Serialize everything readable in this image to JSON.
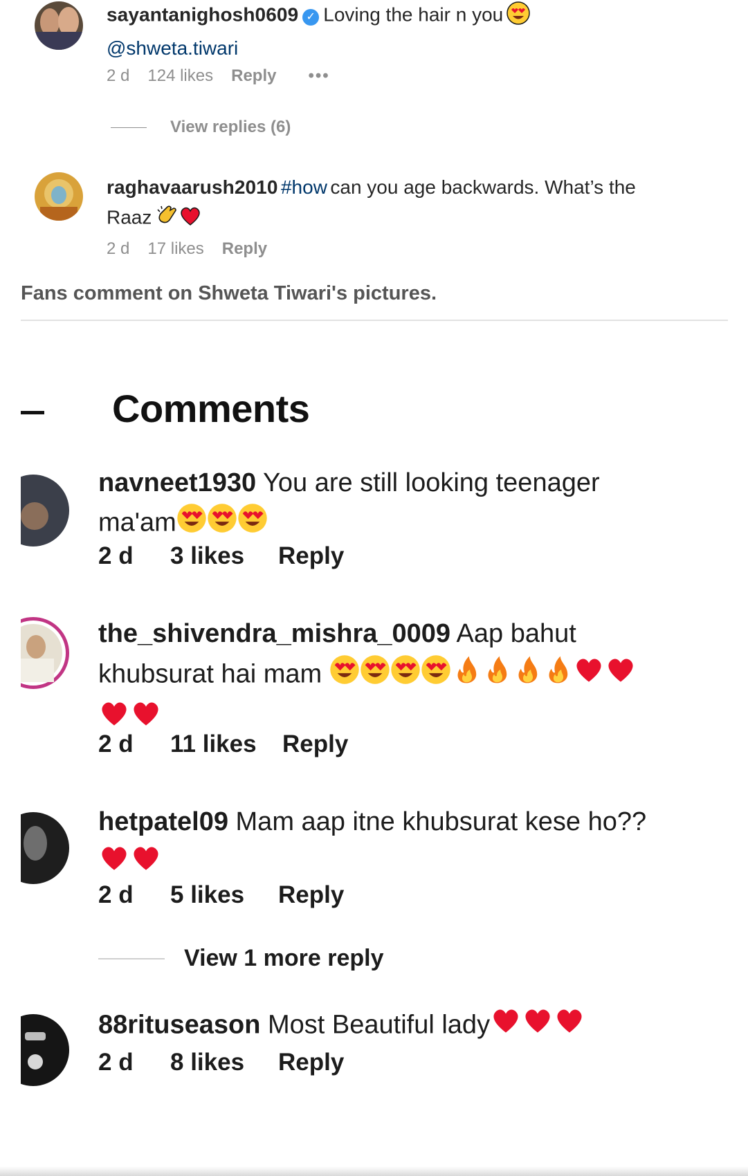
{
  "top": {
    "comments": [
      {
        "username": "sayantanighosh0609",
        "verified": true,
        "text": "Loving the hair n you",
        "emoji": "heart-eyes-emoji",
        "mention": "@shweta.tiwari",
        "time": "2 d",
        "likes": "124 likes",
        "reply": "Reply",
        "more": "•••",
        "view_replies": "View replies (6)"
      },
      {
        "username": "raghavaarush2010",
        "hashtag": "#how",
        "text": "can you age backwards. What’s the",
        "text2": "Raaz",
        "emojis": [
          "clapping-hands-emoji",
          "red-heart-emoji"
        ],
        "time": "2 d",
        "likes": "17 likes",
        "reply": "Reply"
      }
    ]
  },
  "caption": "Fans comment on Shweta Tiwari's pictures.",
  "bottom": {
    "title": "Comments",
    "comments": [
      {
        "username": "navneet1930",
        "text": "You are still looking teenager",
        "text2": "ma'am",
        "emojis": [
          "heart-eyes-emoji",
          "heart-eyes-emoji",
          "heart-eyes-emoji"
        ],
        "time": "2 d",
        "likes": "3 likes",
        "reply": "Reply"
      },
      {
        "username": "the_shivendra_mishra_0009",
        "text": "Aap bahut",
        "text2": "khubsurat hai mam",
        "emojis": [
          "heart-eyes-emoji",
          "heart-eyes-emoji",
          "heart-eyes-emoji",
          "heart-eyes-emoji",
          "fire-emoji",
          "fire-emoji",
          "fire-emoji",
          "fire-emoji",
          "red-heart-emoji",
          "red-heart-emoji",
          "red-heart-emoji",
          "red-heart-emoji"
        ],
        "story_ring": true,
        "time": "2 d",
        "likes": "11 likes",
        "reply": "Reply"
      },
      {
        "username": "hetpatel09",
        "text": "Mam aap itne khubsurat kese ho??",
        "emojis": [
          "red-heart-emoji",
          "red-heart-emoji"
        ],
        "time": "2 d",
        "likes": "5 likes",
        "reply": "Reply",
        "view_more": "View 1 more reply"
      },
      {
        "username": "88rituseason",
        "text": "Most Beautiful lady",
        "emojis": [
          "red-heart-emoji",
          "red-heart-emoji",
          "red-heart-emoji"
        ],
        "time": "2 d",
        "likes": "8 likes",
        "reply": "Reply"
      }
    ]
  },
  "colors": {
    "verified": "#3897f0",
    "link": "#00376b",
    "meta_gray": "#8e8e8e",
    "story_ring": "#c13584",
    "heart": "#e8112d",
    "emoji_yellow": "#ffcc33"
  }
}
